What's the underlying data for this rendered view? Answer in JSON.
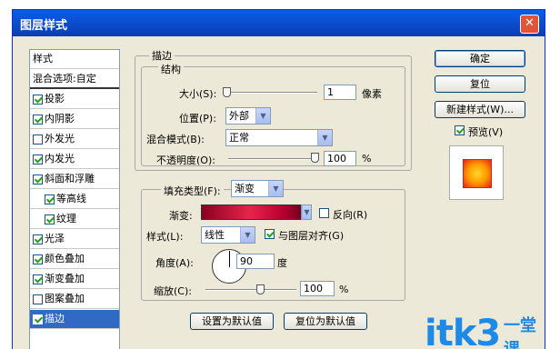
{
  "window": {
    "title": "图层样式",
    "close_glyph": "✕"
  },
  "style_list": {
    "header": "样式",
    "blend": "混合选项:自定",
    "items": [
      {
        "label": "投影",
        "checked": true,
        "indent": false,
        "selected": false
      },
      {
        "label": "内阴影",
        "checked": true,
        "indent": false,
        "selected": false
      },
      {
        "label": "外发光",
        "checked": false,
        "indent": false,
        "selected": false
      },
      {
        "label": "内发光",
        "checked": true,
        "indent": false,
        "selected": false
      },
      {
        "label": "斜面和浮雕",
        "checked": true,
        "indent": false,
        "selected": false
      },
      {
        "label": "等高线",
        "checked": true,
        "indent": true,
        "selected": false
      },
      {
        "label": "纹理",
        "checked": true,
        "indent": true,
        "selected": false
      },
      {
        "label": "光泽",
        "checked": true,
        "indent": false,
        "selected": false
      },
      {
        "label": "颜色叠加",
        "checked": true,
        "indent": false,
        "selected": false
      },
      {
        "label": "渐变叠加",
        "checked": true,
        "indent": false,
        "selected": false
      },
      {
        "label": "图案叠加",
        "checked": false,
        "indent": false,
        "selected": false
      },
      {
        "label": "描边",
        "checked": true,
        "indent": false,
        "selected": true
      }
    ]
  },
  "stroke": {
    "group_title": "描边",
    "structure_title": "结构",
    "size_label": "大小(S):",
    "size_value": "1",
    "size_unit": "像素",
    "position_label": "位置(P):",
    "position_value": "外部",
    "blend_label": "混合模式(B):",
    "blend_value": "正常",
    "opacity_label": "不透明度(O):",
    "opacity_value": "100",
    "opacity_unit": "%"
  },
  "fill": {
    "type_label": "填充类型(F):",
    "type_value": "渐变",
    "gradient_label": "渐变:",
    "reverse_label": "反向(R)",
    "style_label": "样式(L):",
    "style_value": "线性",
    "align_label": "与图层对齐(G)",
    "angle_label": "角度(A):",
    "angle_value": "90",
    "angle_unit": "度",
    "scale_label": "缩放(C):",
    "scale_value": "100",
    "scale_unit": "%"
  },
  "buttons": {
    "ok": "确定",
    "reset": "复位",
    "new_style": "新建样式(W)...",
    "preview": "预览(V)",
    "set_default": "设置为默认值",
    "reset_default": "复位为默认值"
  },
  "watermark": {
    "main": "itk3",
    "sub": "一堂课"
  }
}
